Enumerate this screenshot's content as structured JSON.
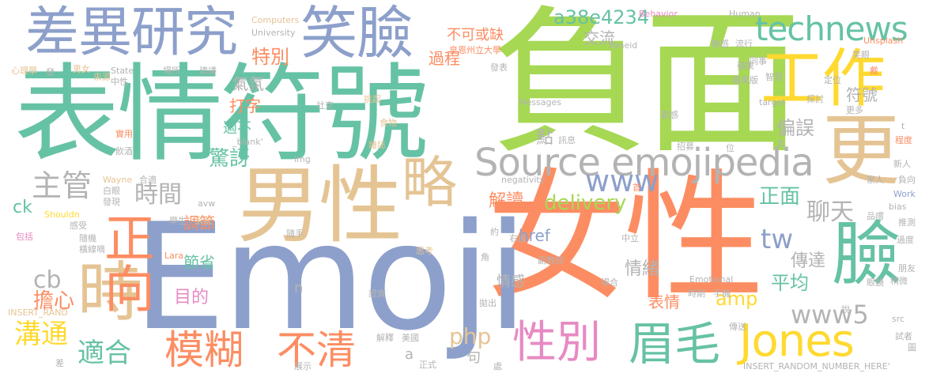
{
  "palette": {
    "green": "#66c2a5",
    "orange": "#fc8d62",
    "blue": "#8da0cb",
    "pink": "#e78ac3",
    "lime": "#a6d854",
    "yellow": "#ffd92f",
    "tan": "#e5c494",
    "gray": "#b3b3b3"
  },
  "words": {
    "fumian": "負面",
    "nvxing": "女性",
    "biaoqing_fuhao": "表情符號",
    "emoji": "Emoji",
    "nanxing": "男性",
    "chayi_yanjiu": "差異研究",
    "xiaolian": "笑臉",
    "gongzuo": "工作",
    "geng": "更",
    "lue": "略",
    "lian": "臉",
    "shi": "時",
    "zhengxiang": "正向",
    "source_emojipedia": "Source emojipedia",
    "technews": "technews",
    "jones": "Jones",
    "meimao": "眉毛",
    "xingbie_big": "性別",
    "buqing": "不清",
    "mohu": "模糊",
    "www": "www",
    "www5": "www5",
    "tw": "tw",
    "zhuguan": "主管",
    "shijian": "時間",
    "liaotian": "聊天",
    "a38e4234": "a38e4234",
    "bukehuoque": "不可或缺",
    "goutong": "溝通",
    "shihe": "適合",
    "danxin": "擔心",
    "delivery": "delivery",
    "jiedu": "解讀",
    "pianwu": "偏誤",
    "fuhao_small": "符號",
    "amp": "amp",
    "zhengmian": "正面",
    "pingjun": "平均",
    "chuanda": "傳達",
    "jingya": "驚訝",
    "tiaojie": "調節",
    "php": "php",
    "biaoqing_small": "表情",
    "qingxu": "情緒",
    "cb": "cb",
    "mude": "目的",
    "tebie": "特別",
    "guocheng": "過程",
    "qifen": "氣氛",
    "dazi": "打字",
    "jiaoliu": "交流",
    "jiesheng": "節省",
    "shibu": "適不",
    "dian": "點",
    "ck": "ck",
    "href": "href",
    "qinggan": "情感",
    "n": "n",
    "ju": "句",
    "a": "a",
    "computers": "Computers",
    "university": "University",
    "behavior": "Behavior",
    "human": "Human",
    "huangzhou": "皇恩州立大學",
    "fabiao": "發表",
    "minggan": "敏感",
    "liuxing": "流行",
    "zoneid": "zoneid",
    "unsplash": "Unsplash",
    "xinlixue": "心理學",
    "fa": "發",
    "nannv": "男女",
    "laiyuan": "來源",
    "state": "State",
    "zhongxing": "中性",
    "changsuo": "場所",
    "jianyi": "建議",
    "pingguo": "蘋果",
    "pingguoban": "蘋果版",
    "xiaoyan": "笑眼",
    "tongshi": "同事",
    "zhihui": "智慧",
    "dingwei": "定位",
    "dai": "戴",
    "messages": "Messages",
    "target": "target",
    "tantao": "探討",
    "gengduo": "更多",
    "shejiao": "社交",
    "tiaoqi": "挑起",
    "shiwu": "食物",
    "zazhi": "雜誌",
    "xunxi": "訊息",
    "wei": "位",
    "zhaomu": "招募",
    "tai": "太",
    "guangan": "觀感",
    "shiyong": "實用",
    "yinjiu": "飲酒",
    "blank": "_blank'",
    "img": "img",
    "chengdu": "程度",
    "xinren": "新人",
    "t": "t",
    "wayne": "Wayne",
    "heshi": "合適",
    "baiyan": "白眼",
    "faxian": "發現",
    "shouldn": "Shouldn",
    "avw": "avw",
    "negativity": "negativity",
    "jiaren": "家人",
    "fuxiang": "負向",
    "work": "Work",
    "pinwei": "品嚐",
    "bias": "bias",
    "tuice": "推測",
    "baokuo": "包括",
    "ganshou": "感受",
    "xuesheng": "學生",
    "xitong": "系統",
    "suishou": "隨手",
    "zhongli": "中立",
    "yue": "約",
    "youbian": "右邊",
    "guodu": "過度",
    "suiji": "隨機",
    "hengxiandi": "橫線嘀",
    "lara": "Lara",
    "sikao": "思考",
    "jiao": "角",
    "fujiaoshou": "副教授",
    "pengyou": "朋友",
    "shaowei": "稍微",
    "yanjing": "眼鏡",
    "shouji": "手機",
    "shiqi": "時期",
    "changhe": "場合",
    "emotional": "Emotional",
    "insert_rand": "INSERT_RAND",
    "paochu": "拋出",
    "zhengshi": "證實",
    "src": "src",
    "shizhe": "試者",
    "chuansong": "傳送",
    "insert_random": "INSERT_RANDOM_NUMBER_HERE'",
    "tu": "圖",
    "cha": "差",
    "zhanshi": "展示",
    "meiguo": "美國",
    "jieshi": "解釋",
    "zhengshi_formal": "正式",
    "chu": "處",
    "shou": "首",
    "shuo": "說"
  }
}
